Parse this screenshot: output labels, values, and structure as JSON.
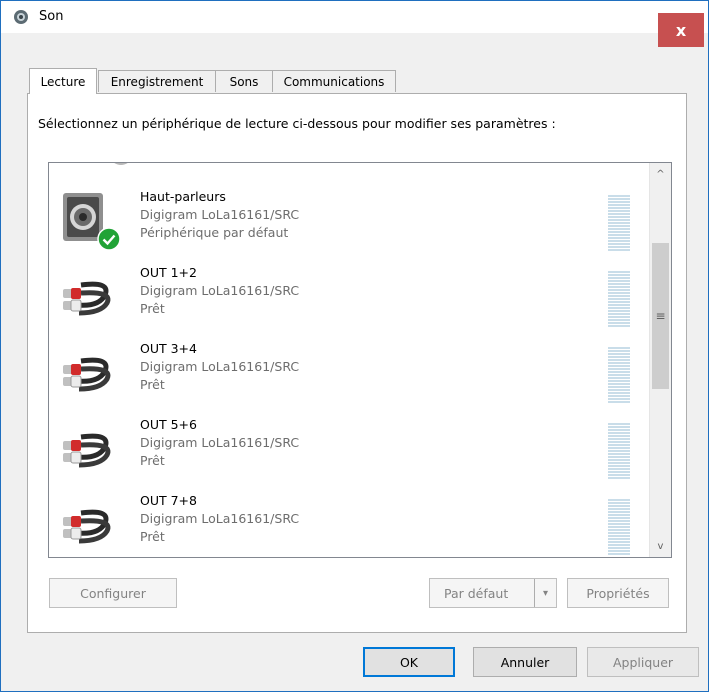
{
  "window": {
    "title": "Son",
    "close_label": "x"
  },
  "tabs": [
    {
      "label": "Lecture",
      "active": true
    },
    {
      "label": "Enregistrement",
      "active": false
    },
    {
      "label": "Sons",
      "active": false
    },
    {
      "label": "Communications",
      "active": false
    }
  ],
  "instruction": "Sélectionnez un périphérique de lecture ci-dessous pour modifier ses paramètres :",
  "devices": [
    {
      "name": "Haut-parleurs",
      "driver": "Digigram LoLa16161/SRC",
      "status": "Périphérique par défaut",
      "icon": "speaker-icon",
      "default": true
    },
    {
      "name": "OUT 1+2",
      "driver": "Digigram LoLa16161/SRC",
      "status": "Prêt",
      "icon": "rca-cable-icon",
      "default": false
    },
    {
      "name": "OUT 3+4",
      "driver": "Digigram LoLa16161/SRC",
      "status": "Prêt",
      "icon": "rca-cable-icon",
      "default": false
    },
    {
      "name": "OUT 5+6",
      "driver": "Digigram LoLa16161/SRC",
      "status": "Prêt",
      "icon": "rca-cable-icon",
      "default": false
    },
    {
      "name": "OUT 7+8",
      "driver": "Digigram LoLa16161/SRC",
      "status": "Prêt",
      "icon": "rca-cable-icon",
      "default": false
    }
  ],
  "scrollbar": {
    "up_glyph": "^",
    "down_glyph": "v",
    "thumb_glyph": "≡"
  },
  "buttons": {
    "configure": "Configurer",
    "set_default": "Par défaut",
    "set_default_arrow": "▾",
    "properties": "Propriétés",
    "ok": "OK",
    "cancel": "Annuler",
    "apply": "Appliquer"
  },
  "colors": {
    "close_button": "#c75050",
    "accent": "#0078d7",
    "default_check": "#21a336"
  }
}
